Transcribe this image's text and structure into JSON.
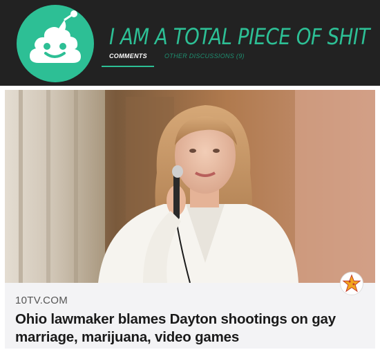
{
  "header": {
    "title": "I AM A TOTAL PIECE OF SHIT",
    "tabs": [
      {
        "label": "COMMENTS",
        "active": true
      },
      {
        "label": "OTHER DISCUSSIONS (9)",
        "active": false
      }
    ],
    "accent_color": "#2dbf95",
    "background_color": "#222222",
    "logo_icon": "poop-emoji-icon"
  },
  "post": {
    "domain": "10TV.COM",
    "headline": "Ohio lawmaker blames Dayton shootings on gay marriage, marijuana, video games",
    "thumbnail": "photo-woman-speaking-into-microphone",
    "award_icon": "star-award-icon"
  }
}
